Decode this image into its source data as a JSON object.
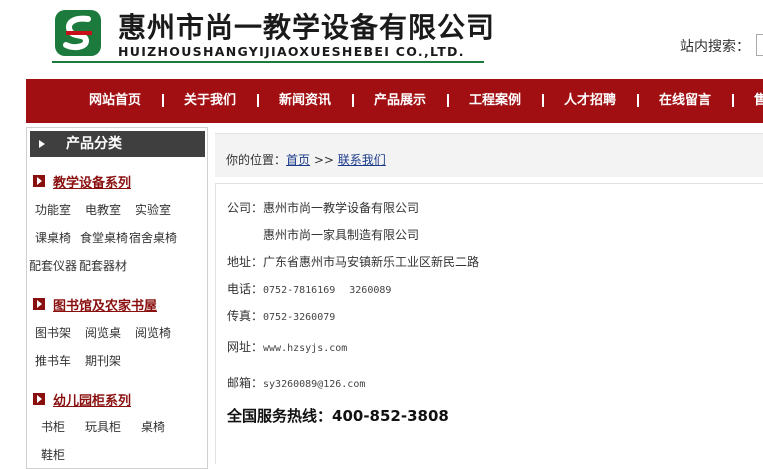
{
  "header": {
    "company_cn": "惠州市尚一教学设备有限公司",
    "company_en": "HUIZHOUSHANGYIJIAOXUESHEBEI CO.,LTD.",
    "search_label": "站内搜索：",
    "logo_icon": "company-logo-icon",
    "colors": {
      "logo_green": "#1b7a3c",
      "logo_red": "#c8101a"
    }
  },
  "nav": {
    "items": [
      "网站首页",
      "关于我们",
      "新闻资讯",
      "产品展示",
      "工程案例",
      "人才招聘",
      "在线留言",
      "售"
    ],
    "background": "#a20f12"
  },
  "sidebar": {
    "title": "产品分类",
    "categories": [
      {
        "title": "教学设备系列",
        "items": [
          "功能室",
          "电教室",
          "实验室",
          "课桌椅",
          "食堂桌椅",
          "宿舍桌椅",
          "配套仪器",
          "配套器材"
        ]
      },
      {
        "title": "图书馆及农家书屋",
        "items": [
          "图书架",
          "阅览桌",
          "阅览椅",
          "推书车",
          "期刊架"
        ]
      },
      {
        "title": "幼儿园柜系列",
        "items": [
          "书柜",
          "玩具柜",
          "桌椅",
          "鞋柜"
        ]
      }
    ]
  },
  "breadcrumb": {
    "prefix": "你的位置：",
    "home": "首页",
    "sep": ">>",
    "current": "联系我们"
  },
  "contact": {
    "company_label": "公司：",
    "company_1": "惠州市尚一教学设备有限公司",
    "company_2": "惠州市尚一家具制造有限公司",
    "address_label": "地址：",
    "address": "广东省惠州市马安镇新乐工业区新民二路",
    "phone_label": "电话：",
    "phone_1": "0752-7816169",
    "phone_2": "3260089",
    "fax_label": "传真：",
    "fax": "0752-3260079",
    "web_label": "网址：",
    "web": "www.hzsyjs.com",
    "email_label": "邮箱：",
    "email": "sy3260089@126.com",
    "hotline_label": "全国服务热线：",
    "hotline": "400-852-3808"
  }
}
